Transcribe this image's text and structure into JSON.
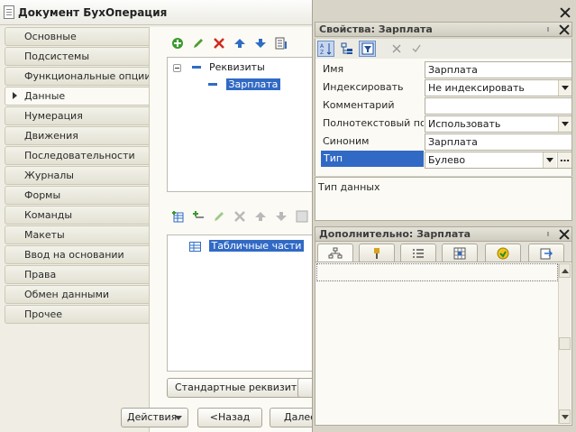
{
  "doc_window": {
    "title": "Документ БухОперация"
  },
  "nav": {
    "items": [
      {
        "label": "Основные"
      },
      {
        "label": "Подсистемы"
      },
      {
        "label": "Функциональные опции"
      },
      {
        "label": "Данные"
      },
      {
        "label": "Нумерация"
      },
      {
        "label": "Движения"
      },
      {
        "label": "Последовательности"
      },
      {
        "label": "Журналы"
      },
      {
        "label": "Формы"
      },
      {
        "label": "Команды"
      },
      {
        "label": "Макеты"
      },
      {
        "label": "Ввод на основании"
      },
      {
        "label": "Права"
      },
      {
        "label": "Обмен данными"
      },
      {
        "label": "Прочее"
      }
    ],
    "active_index": 3
  },
  "attributes_tree": {
    "root_label": "Реквизиты",
    "items": [
      {
        "label": "Зарплата"
      }
    ]
  },
  "tabular_tree": {
    "root_label": "Табличные части"
  },
  "buttons": {
    "standard_attributes": "Стандартные реквизиты",
    "actions": "Действия",
    "back": "<Назад",
    "next": "Далее"
  },
  "properties_panel": {
    "title": "Свойства: Зарплата",
    "rows": [
      {
        "label": "Имя",
        "value": "Зарплата",
        "control": "text"
      },
      {
        "label": "Индексировать",
        "value": "Не индексировать",
        "control": "select"
      },
      {
        "label": "Комментарий",
        "value": "",
        "control": "text"
      },
      {
        "label": "Полнотекстовый поиск",
        "value": "Использовать",
        "control": "select"
      },
      {
        "label": "Синоним",
        "value": "Зарплата",
        "control": "text"
      },
      {
        "label": "Тип",
        "value": "Булево",
        "control": "select-ellipsis",
        "selected": true
      }
    ],
    "description": "Тип данных"
  },
  "extra_panel": {
    "title": "Дополнительно: Зарплата"
  },
  "colors": {
    "selection": "#316ac5",
    "window_bg": "#f0eee4",
    "panel_header": "#cfccbf"
  },
  "icons": {
    "toolbar_top": [
      "add-icon",
      "edit-icon",
      "delete-icon",
      "move-up-icon",
      "move-down-icon",
      "sort-icon"
    ],
    "toolbar_bottom": [
      "add-table-icon",
      "add-column-icon",
      "edit-icon",
      "delete-icon",
      "move-up-icon",
      "move-down-icon",
      "sort-icon"
    ],
    "properties_toolbar": [
      "sort-alpha-icon",
      "category-icon",
      "filter-icon",
      "cancel-icon",
      "apply-icon"
    ],
    "extra_tabs": [
      "hierarchy-icon",
      "pin-icon",
      "list-icon",
      "table-icon",
      "refresh-icon",
      "export-icon"
    ]
  }
}
